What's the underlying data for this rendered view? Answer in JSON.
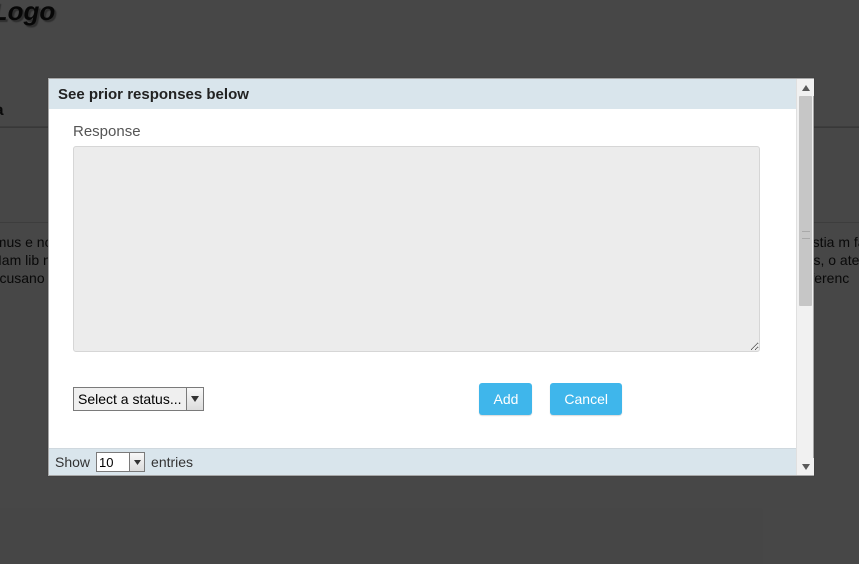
{
  "bg": {
    "logo": "y Logo",
    "admin": "nistra",
    "lorem_left": "samus e non p Nam lib nis do cusano",
    "lorem_right": "olestia m faci mus, o ates re ferenc"
  },
  "modal": {
    "title": "See prior responses below",
    "response_label": "Response",
    "response_value": "",
    "status_placeholder": "Select a status...",
    "add_label": "Add",
    "cancel_label": "Cancel"
  },
  "footer": {
    "show_label": "Show",
    "entries_label": "entries",
    "page_size": "10"
  }
}
